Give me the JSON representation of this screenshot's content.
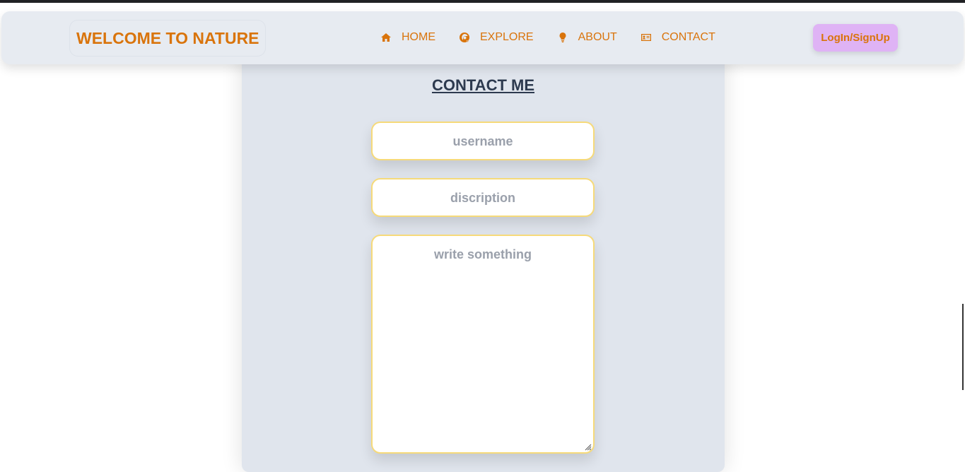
{
  "header": {
    "brand": "WELCOME TO NATURE",
    "nav": [
      {
        "label": "HOME",
        "icon": "home-icon"
      },
      {
        "label": "EXPLORE",
        "icon": "explore-icon"
      },
      {
        "label": "ABOUT",
        "icon": "bulb-icon"
      },
      {
        "label": "CONTACT",
        "icon": "contact-card-icon"
      }
    ],
    "login_label": "LogIn/SignUp"
  },
  "form": {
    "title": "CONTACT ME",
    "username_placeholder": "username",
    "description_placeholder": "discription",
    "message_placeholder": "write something"
  },
  "colors": {
    "accent": "#d9740c",
    "login_bg": "#dfb3f5",
    "field_border": "#f6da7a",
    "card_bg": "#e0e5ed"
  }
}
